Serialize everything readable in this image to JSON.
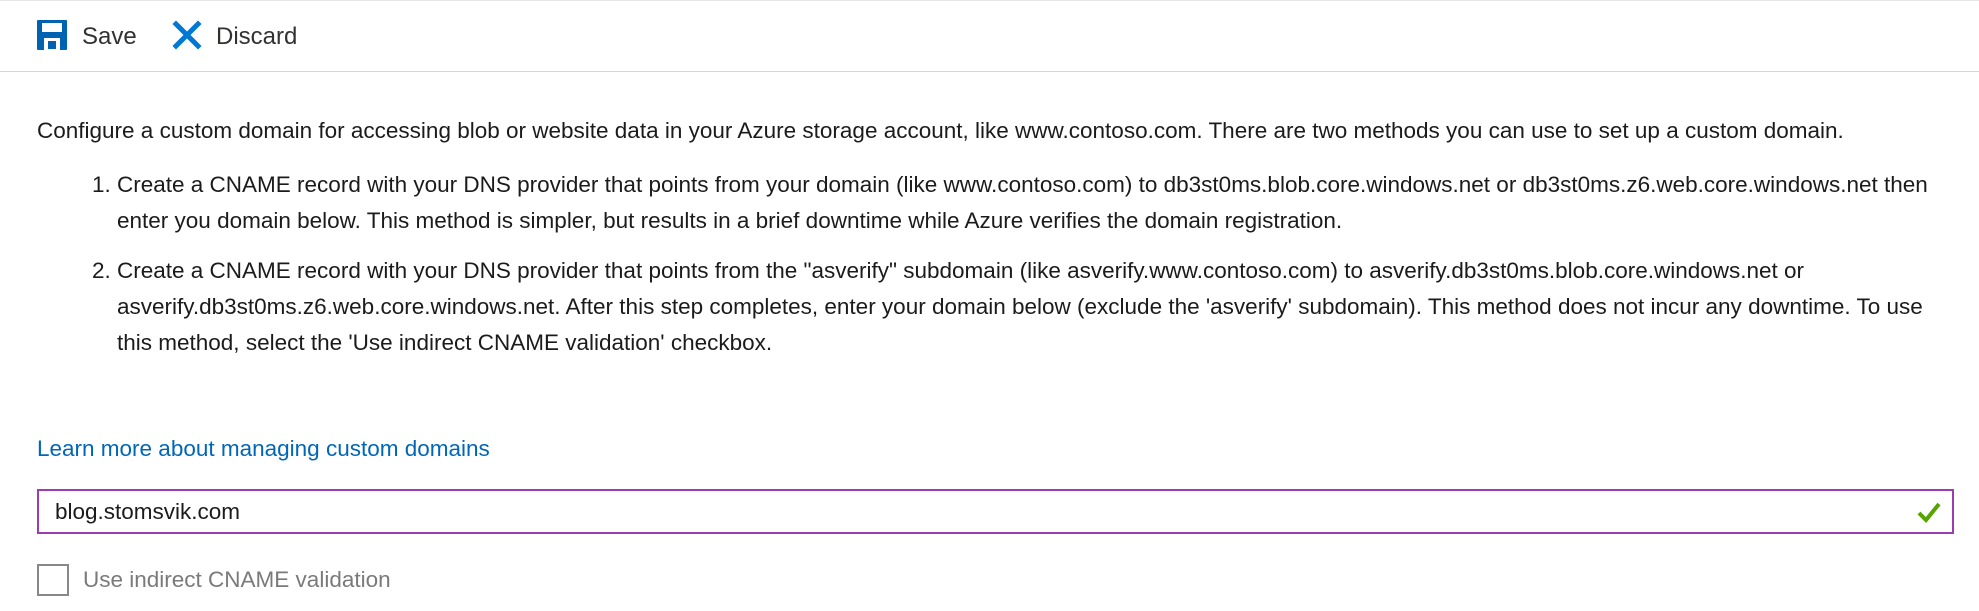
{
  "toolbar": {
    "save_label": "Save",
    "discard_label": "Discard"
  },
  "content": {
    "intro": "Configure a custom domain for accessing blob or website data in your Azure storage account, like www.contoso.com. There are two methods you can use to set up a custom domain.",
    "steps": [
      "Create a CNAME record with your DNS provider that points from your domain (like www.contoso.com) to db3st0ms.blob.core.windows.net or db3st0ms.z6.web.core.windows.net then enter you domain below. This method is simpler, but results in a brief downtime while Azure verifies the domain registration.",
      "Create a CNAME record with your DNS provider that points from the \"asverify\" subdomain (like asverify.www.contoso.com) to asverify.db3st0ms.blob.core.windows.net or asverify.db3st0ms.z6.web.core.windows.net. After this step completes, enter your domain below (exclude the 'asverify' subdomain). This method does not incur any downtime. To use this method, select the 'Use indirect CNAME validation' checkbox."
    ],
    "learn_more_link": "Learn more about managing custom domains"
  },
  "domain_field": {
    "value": "blog.stomsvik.com",
    "valid": true
  },
  "indirect_validation": {
    "label": "Use indirect CNAME validation",
    "checked": false
  },
  "colors": {
    "accent": "#0067b8",
    "save_icon": "#0063b1",
    "discard_icon": "#0078d4",
    "input_border_focus": "#9c3cb3",
    "valid_check": "#57a300"
  },
  "icons": {
    "save": "save-icon",
    "discard": "close-icon",
    "valid": "checkmark-icon"
  }
}
